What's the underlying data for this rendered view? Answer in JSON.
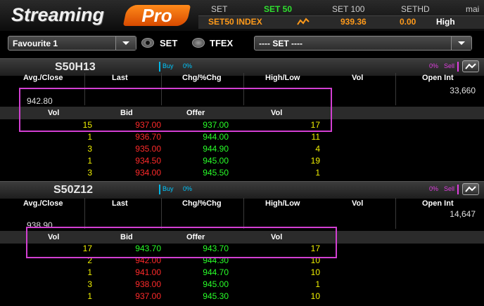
{
  "app": {
    "logo_streaming": "Streaming",
    "logo_pro": "Pro"
  },
  "market_tabs": [
    "SET",
    "SET 50",
    "SET 100",
    "SETHD",
    "mai"
  ],
  "index": {
    "name": "SET50 INDEX",
    "value": "939.36",
    "change": "0.00",
    "status": "High"
  },
  "controls": {
    "favourite": "Favourite 1",
    "radio_set": "SET",
    "radio_tfex": "TFEX",
    "market_select": "---- SET ----"
  },
  "columns": {
    "avg_close": "Avg./Close",
    "last": "Last",
    "chg": "Chg/%Chg",
    "high_low": "High/Low",
    "vol": "Vol",
    "open_int": "Open Int",
    "bid": "Bid",
    "offer": "Offer"
  },
  "panels": [
    {
      "symbol": "S50H13",
      "buy_label": "Buy",
      "buy_pct": "0%",
      "sell_label": "Sell",
      "sell_pct": "0%",
      "avg_close": "942.80",
      "open_int": "33,660",
      "depth": [
        {
          "bid_vol": "15",
          "bid": "937.00",
          "offer": "937.00",
          "offer_vol": "17"
        },
        {
          "bid_vol": "1",
          "bid": "936.70",
          "offer": "944.00",
          "offer_vol": "11"
        },
        {
          "bid_vol": "3",
          "bid": "935.00",
          "offer": "944.90",
          "offer_vol": "4"
        },
        {
          "bid_vol": "1",
          "bid": "934.50",
          "offer": "945.00",
          "offer_vol": "19"
        },
        {
          "bid_vol": "3",
          "bid": "934.00",
          "offer": "945.50",
          "offer_vol": "1"
        }
      ]
    },
    {
      "symbol": "S50Z12",
      "buy_label": "Buy",
      "buy_pct": "0%",
      "sell_label": "Sell",
      "sell_pct": "0%",
      "avg_close": "938.90",
      "open_int": "14,647",
      "depth": [
        {
          "bid_vol": "17",
          "bid": "943.70",
          "offer": "943.70",
          "offer_vol": "17"
        },
        {
          "bid_vol": "2",
          "bid": "942.00",
          "offer": "944.30",
          "offer_vol": "10"
        },
        {
          "bid_vol": "1",
          "bid": "941.00",
          "offer": "944.70",
          "offer_vol": "10"
        },
        {
          "bid_vol": "3",
          "bid": "938.00",
          "offer": "945.00",
          "offer_vol": "1"
        },
        {
          "bid_vol": "1",
          "bid": "937.00",
          "offer": "945.30",
          "offer_vol": "10"
        }
      ]
    }
  ],
  "colors": {
    "accent_orange": "#ff8a1a",
    "bid_red": "#ff2a2a",
    "offer_green": "#28ff28",
    "vol_yellow": "#f0f000",
    "highlight": "#d23fd2"
  }
}
